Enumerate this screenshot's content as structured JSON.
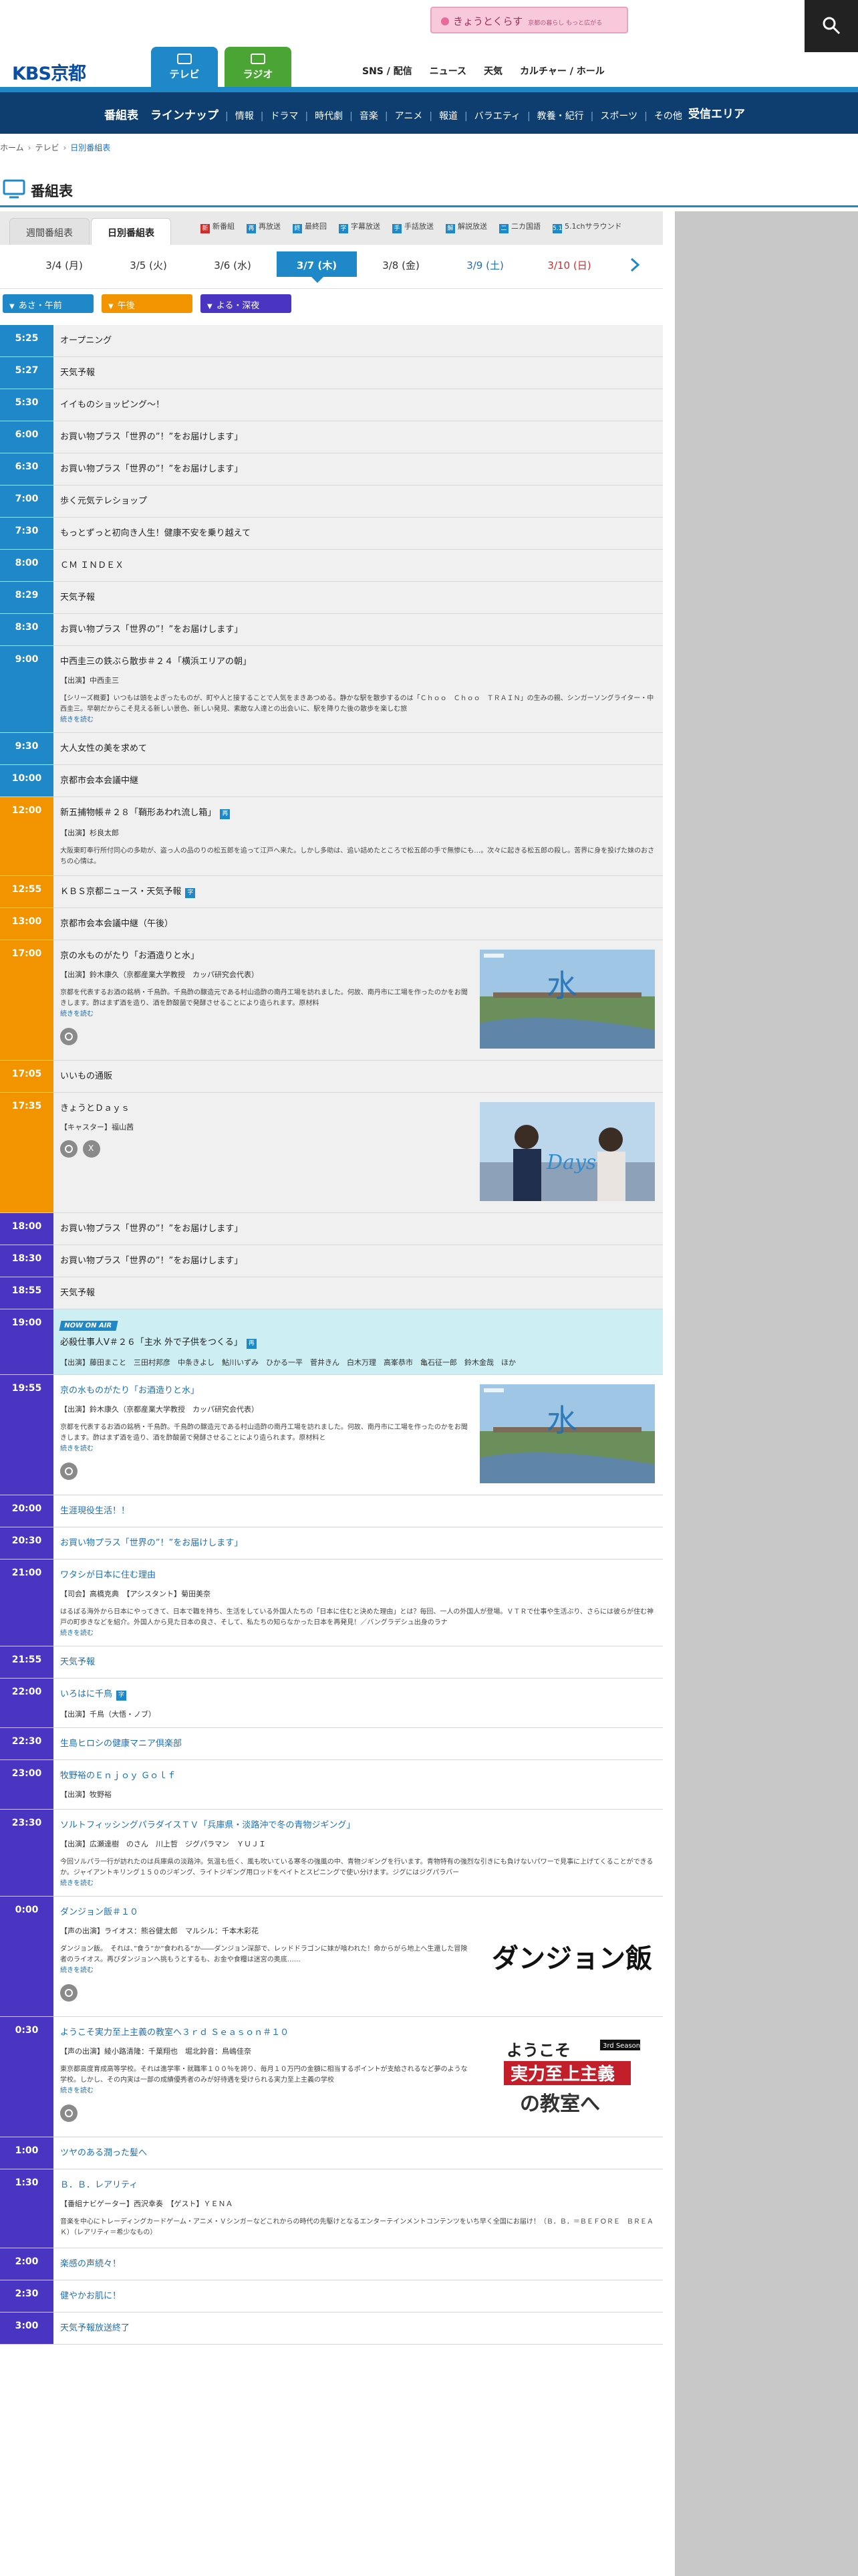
{
  "promo": {
    "title": "きょうとくらす",
    "sub": "京都の暮らし もっと広がる"
  },
  "header": {
    "logo": "KBS京都",
    "tabs": [
      {
        "label": "テレビ"
      },
      {
        "label": "ラジオ"
      }
    ],
    "utility": [
      "SNS / 配信",
      "ニュース",
      "天気",
      "カルチャー / ホール"
    ]
  },
  "catnav": {
    "items": [
      "番組表",
      "ラインナップ",
      "情報",
      "ドラマ",
      "時代劇",
      "音楽",
      "アニメ",
      "報道",
      "バラエティ",
      "教養・紀行",
      "スポーツ",
      "その他"
    ],
    "area": "受信エリア"
  },
  "breadcrumb": [
    "ホーム",
    "テレビ",
    "日別番組表"
  ],
  "page_title": "番組表",
  "view_tabs": [
    "週間番組表",
    "日別番組表"
  ],
  "legend": [
    {
      "mark": "新",
      "label": "新番組",
      "color": "#d12c2c"
    },
    {
      "mark": "再",
      "label": "再放送",
      "color": "#1e88c9"
    },
    {
      "mark": "終",
      "label": "最終回",
      "color": "#1e88c9"
    },
    {
      "mark": "字",
      "label": "字幕放送",
      "color": "#1e88c9"
    },
    {
      "mark": "手",
      "label": "手話放送",
      "color": "#1e88c9"
    },
    {
      "mark": "解",
      "label": "解説放送",
      "color": "#1e88c9"
    },
    {
      "mark": "二",
      "label": "二カ国語",
      "color": "#1e88c9"
    },
    {
      "mark": "5.1",
      "label": "5.1chサラウンド",
      "color": "#1e88c9"
    }
  ],
  "dates": [
    "3/4 (月)",
    "3/5 (火)",
    "3/6 (水)",
    "3/7 (木)",
    "3/8 (金)",
    "3/9 (土)",
    "3/10 (日)"
  ],
  "jumps": [
    "あさ・午前",
    "午後",
    "よる・深夜"
  ],
  "more_label": "続きを読む",
  "onair_label": "NOW ON AIR",
  "schedule": [
    {
      "time": "5:25",
      "title": "オープニング"
    },
    {
      "time": "5:27",
      "title": "天気予報"
    },
    {
      "time": "5:30",
      "title": "イイものショッピング〜！"
    },
    {
      "time": "6:00",
      "title": "お買い物プラス「世界の”！”をお届けします」"
    },
    {
      "time": "6:30",
      "title": "お買い物プラス「世界の”！”をお届けします」"
    },
    {
      "time": "7:00",
      "title": "歩く元気テレショップ"
    },
    {
      "time": "7:30",
      "title": "もっとずっと初向き人生！健康不安を乗り越えて"
    },
    {
      "time": "8:00",
      "title": "ＣＭ ＩＮＤＥＸ"
    },
    {
      "time": "8:29",
      "title": "天気予報"
    },
    {
      "time": "8:30",
      "title": "お買い物プラス「世界の”！”をお届けします」"
    },
    {
      "time": "9:00",
      "title": "中西圭三の鉄ぶら散歩＃２４「横浜エリアの朝」",
      "cast": "【出演】中西圭三",
      "desc": "【シリーズ概要】いつもは頭をよぎったものが、町や人と接することで人気をまきあつめる。静かな駅を散歩するのは「Ｃｈｏｏ　Ｃｈｏｏ　ＴＲＡＩＮ」の生みの親、シンガーソングライター・中西圭三。早朝だからこそ見える新しい景色、新しい発見、素敵な人達との出会いに、駅を降りた後の散歩を楽しむ旅",
      "more": true
    },
    {
      "time": "9:30",
      "title": "大人女性の美を求めて"
    },
    {
      "time": "10:00",
      "title": "京都市会本会議中継"
    },
    {
      "time": "12:00",
      "title": "新五捕物帳＃２８「鞘形あわれ流し箱」",
      "badge": "再",
      "cast": "【出演】杉良太郎",
      "desc": "大阪東町奉行所付同心の多助が、盗っ人の品のりの松五郎を追って江戸へ来た。しかし多助は、追い詰めたところで松五郎の手で無惨にも…。次々に起きる松五郎の殺し。苦界に身を投げた妹のおさちの心情は。"
    },
    {
      "time": "12:55",
      "title": "ＫＢＳ京都ニュース・天気予報",
      "badge": "字"
    },
    {
      "time": "13:00",
      "title": "京都市会本会議中継（午後）"
    },
    {
      "time": "17:00",
      "title": "京の水ものがたり「お酒造りと水」",
      "cast": "【出演】鈴木康久（京都産業大学教授　カッパ研究会代表）",
      "desc": "京都を代表するお酒の銘柄・千鳥酢。千鳥酢の醸造元である村山造酢の南丹工場を訪れました。何故、南丹市に工場を作ったのかをお聞きします。酢はまず酒を造り、酒を酢酸菌で発酵させることにより造られます。原材料",
      "more": true,
      "thumb": "river",
      "icons": [
        "web"
      ]
    },
    {
      "time": "17:05",
      "title": "いいもの通販"
    },
    {
      "time": "17:35",
      "title": "きょうとＤａｙｓ",
      "cast": "【キャスター】福山茜",
      "thumb": "days",
      "icons": [
        "web",
        "x"
      ]
    },
    {
      "time": "18:00",
      "title": "お買い物プラス「世界の”！”をお届けします」"
    },
    {
      "time": "18:30",
      "title": "お買い物プラス「世界の”！”をお届けします」"
    },
    {
      "time": "18:55",
      "title": "天気予報"
    },
    {
      "time": "19:00",
      "title": "必殺仕事人Ⅴ＃２６「主水 外で子供をつくる」",
      "badge": "再",
      "cast": "【出演】藤田まこと　三田村邦彦　中条きよし　鮎川いずみ　ひかる一平　菅井きん　白木万理　高峯恭市　亀石征一郎　鈴木金哉　ほか",
      "onair": true
    },
    {
      "time": "19:55",
      "title": "京の水ものがたり「お酒造りと水」",
      "cast": "【出演】鈴木康久（京都産業大学教授　カッパ研究会代表）",
      "desc": "京都を代表するお酒の銘柄・千鳥酢。千鳥酢の醸造元である村山造酢の南丹工場を訪れました。何故、南丹市に工場を作ったのかをお聞きします。酢はまず酒を造り、酒を酢酸菌で発酵させることにより造られます。原材料と",
      "more": true,
      "thumb": "river",
      "icons": [
        "web"
      ],
      "white": true
    },
    {
      "time": "20:00",
      "title": "生涯現役生活！！",
      "white": true
    },
    {
      "time": "20:30",
      "title": "お買い物プラス「世界の”！”をお届けします」",
      "white": true
    },
    {
      "time": "21:00",
      "title": "ワタシが日本に住む理由",
      "cast": "【司会】高橋克典　【アシスタント】菊田美奈",
      "desc": "はるばる海外から日本にやってきて、日本で職を持ち、生活をしている外国人たちの「日本に住むと決めた理由」とは？毎回、一人の外国人が登場。ＶＴＲで仕事や生活ぶり、さらには彼らが住む神戸の町歩きなどを紹介。外国人から見た日本の良さ、そして、私たちの知らなかった日本を再発見！／バングラデシュ出身のラナ",
      "more": true,
      "white": true
    },
    {
      "time": "21:55",
      "title": "天気予報",
      "white": true
    },
    {
      "time": "22:00",
      "title": "いろはに千鳥",
      "badge": "字",
      "cast": "【出演】千鳥（大悟・ノブ）",
      "white": true
    },
    {
      "time": "22:30",
      "title": "生島ヒロシの健康マニア倶楽部",
      "white": true
    },
    {
      "time": "23:00",
      "title": "牧野裕のＥｎｊｏｙ Ｇｏｌｆ",
      "cast": "【出演】牧野裕",
      "white": true
    },
    {
      "time": "23:30",
      "title": "ソルトフィッシングパラダイスＴＶ「兵庫県・淡路沖で冬の青物ジギング」",
      "cast": "【出演】広瀬達樹　のさん　川上哲　ジグパラマン　ＹＵＪＩ",
      "desc": "今回ソルパラ一行が訪れたのは兵庫県の淡路沖。気温も低く、風も吹いている寒冬の強風の中、青物ジギングを行います。青物特有の強烈な引きにも負けないパワーで見事に上げてくることができるか。ジャイアントキリング１５０のジギング、ライトジギング用ロッドをベイトとスピニングで使い分けます。ジグにはジグパラバー",
      "more": true,
      "white": true
    },
    {
      "time": "0:00",
      "title": "ダンジョン飯＃１０",
      "cast": "【声の出演】ライオス：熊谷健太郎　マルシル：千本木彩花",
      "desc": "ダンジョン飯。　それは、”食う”か”食われる”か――ダンジョン深部で、レッドドラゴンに妹が喰われた！命からがら地上へ生還した冒険者のライオス。再びダンジョンへ挑もうとするも、お金や食糧は迷宮の奥底……",
      "more": true,
      "thumb": "dungeon",
      "icons": [
        "web"
      ],
      "white": true
    },
    {
      "time": "0:30",
      "title": "ようこそ実力至上主義の教室へ３ｒｄ Ｓｅａｓｏｎ＃１０",
      "cast": "【声の出演】綾小路清隆：千葉翔也　堀北鈴音：鳥嶋佳奈",
      "desc": "東京都高度育成高等学校。それは進学率・就職率１００％を誇り、毎月１０万円の金額に相当するポイントが支給されるなど夢のような学校。しかし、その内実は一部の成績優秀者のみが好待遇を受けられる実力至上主義の学校",
      "more": true,
      "thumb": "classroom",
      "icons": [
        "web"
      ],
      "white": true
    },
    {
      "time": "1:00",
      "title": "ツヤのある潤った髪へ",
      "white": true
    },
    {
      "time": "1:30",
      "title": "Ｂ．Ｂ．レアリティ",
      "cast": "【番組ナビゲーター】西沢幸奏　【ゲスト】ＹＥＮＡ",
      "desc": "音楽を中心にトレーディングカードゲーム・アニメ・Ｖシンガーなどこれからの時代の先駆けとなるエンターテインメントコンテンツをいち早く全国にお届け！（Ｂ．Ｂ．＝ＢＥＦＯＲＥ　ＢＲＥＡＫ）（レアリティ＝希少なもの）",
      "white": true
    },
    {
      "time": "2:00",
      "title": "楽感の声続々！",
      "white": true
    },
    {
      "time": "2:30",
      "title": "健やかお肌に！",
      "white": true
    },
    {
      "time": "3:00",
      "title": "天気予報放送終了",
      "white": true
    }
  ],
  "colors": {
    "morning": "#1e88c9",
    "afternoon": "#f29400",
    "night": "#4a35c2",
    "onair": "#cdeef2",
    "nav": "#0d3e6f"
  }
}
